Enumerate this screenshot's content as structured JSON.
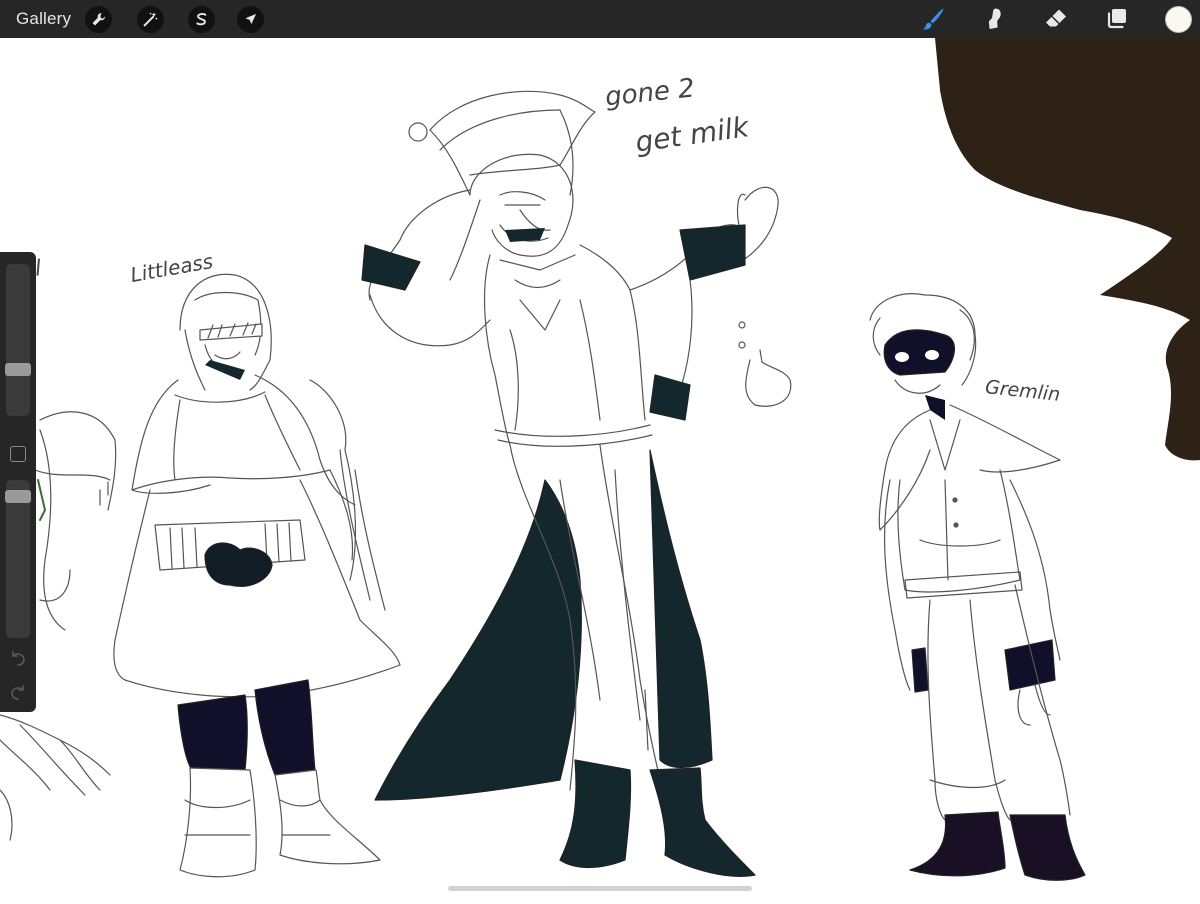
{
  "toolbar": {
    "gallery_label": "Gallery",
    "left_tools": [
      {
        "icon": "wrench-icon",
        "name": "actions"
      },
      {
        "icon": "magic-wand-icon",
        "name": "adjustments"
      },
      {
        "icon": "selection-s-icon",
        "name": "selection"
      },
      {
        "icon": "arrow-cursor-icon",
        "name": "transform"
      }
    ],
    "right_tools": [
      {
        "icon": "brush-icon",
        "name": "paint",
        "active": true
      },
      {
        "icon": "smudge-icon",
        "name": "smudge"
      },
      {
        "icon": "eraser-icon",
        "name": "erase"
      },
      {
        "icon": "layers-icon",
        "name": "layers"
      }
    ],
    "current_color": "#fbf8ee",
    "active_color": "#3d8ef0"
  },
  "sidebar": {
    "brush_size": 0.66,
    "opacity": 0.96
  },
  "canvas": {
    "labels": {
      "left_girl": "girl",
      "littleass": "Littleass",
      "gone": "gone 2",
      "milk": "get milk",
      "gremlin": "Gremlin"
    },
    "colors": {
      "ink": "#555555",
      "coat_dark": "#13272c",
      "pants_dark": "#10102a",
      "boots_dark": "#1a1026",
      "blob_brown": "#2e2116"
    }
  }
}
